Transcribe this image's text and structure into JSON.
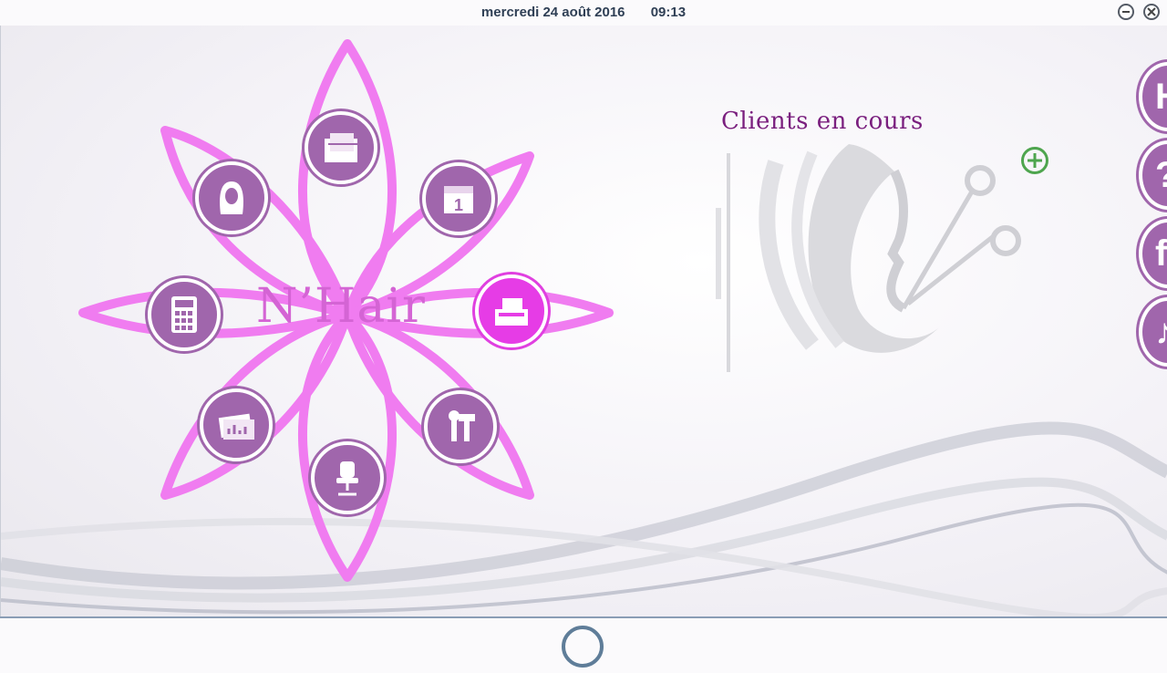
{
  "header": {
    "date": "mercredi 24 août 2016",
    "time": "09:13"
  },
  "logo": {
    "text": "N’Hair",
    "color": "#d464d4"
  },
  "clients": {
    "title": "Clients en cours"
  },
  "colors": {
    "petal": "#f07cf0",
    "button": "#a066ac",
    "button_active": "#e63ce6",
    "add": "#4ea54e",
    "title": "#7a1f7e"
  },
  "menu": [
    {
      "icon": "folder-documents-icon"
    },
    {
      "icon": "calendar-icon"
    },
    {
      "icon": "cash-register-icon"
    },
    {
      "icon": "tools-icon"
    },
    {
      "icon": "salon-chair-icon"
    },
    {
      "icon": "reports-icon"
    },
    {
      "icon": "calculator-icon"
    },
    {
      "icon": "hair-client-icon"
    }
  ],
  "side_menu": [
    {
      "icon": "h-icon",
      "glyph": "H"
    },
    {
      "icon": "question-icon",
      "glyph": "?"
    },
    {
      "icon": "facebook-icon",
      "glyph": "f"
    },
    {
      "icon": "music-icon",
      "glyph": "♪"
    }
  ]
}
